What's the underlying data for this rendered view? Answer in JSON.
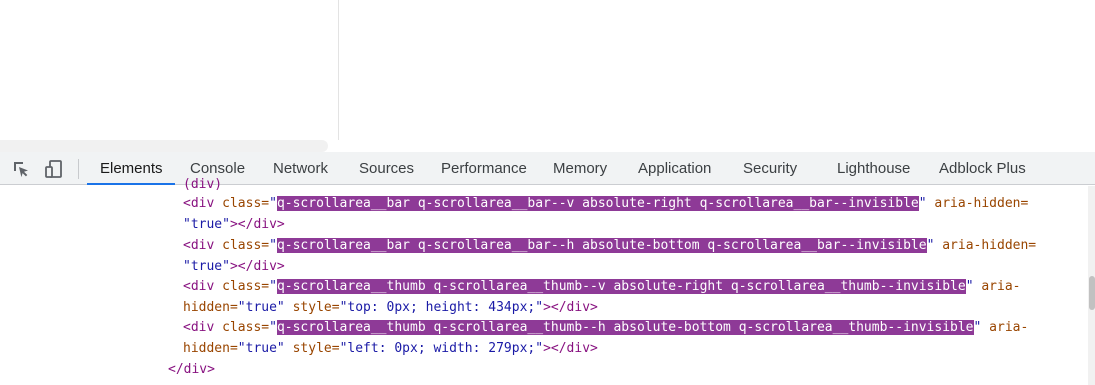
{
  "toolbar": {
    "inspect_icon": "element-picker-icon",
    "device_icon": "device-toolbar-icon",
    "tabs": [
      {
        "label": "Elements",
        "active": true
      },
      {
        "label": "Console"
      },
      {
        "label": "Network"
      },
      {
        "label": "Sources"
      },
      {
        "label": "Performance"
      },
      {
        "label": "Memory"
      },
      {
        "label": "Application"
      },
      {
        "label": "Security"
      },
      {
        "label": "Lighthouse"
      },
      {
        "label": "Adblock Plus"
      }
    ]
  },
  "colors": {
    "highlight": "#8e3a97",
    "tag": "#881280",
    "attr": "#994500",
    "value": "#1a1aa6",
    "active_tab_underline": "#1a73e8"
  },
  "code": {
    "clipped_top": "(div)",
    "lines": [
      {
        "open": "<div",
        "attr1": " class=",
        "q1": "\"",
        "hl": "q-scrollarea__bar q-scrollarea__bar--v absolute-right q-scrollarea__bar--invisible",
        "q2": "\"",
        "attr2": " aria-hidden=",
        "cont": "\"true\"",
        "close": "></div>"
      },
      {
        "open": "<div",
        "attr1": " class=",
        "q1": "\"",
        "hl": "q-scrollarea__bar q-scrollarea__bar--h absolute-bottom q-scrollarea__bar--invisible",
        "q2": "\"",
        "attr2": " aria-hidden=",
        "cont": "\"true\"",
        "close": "></div>"
      },
      {
        "open": "<div",
        "attr1": " class=",
        "q1": "\"",
        "hl": "q-scrollarea__thumb q-scrollarea__thumb--v absolute-right q-scrollarea__thumb--invisible",
        "q2": "\"",
        "attr2": " aria-",
        "cont_attr": "hidden=",
        "cont_val": "\"true\"",
        "style_attr": " style=",
        "style_val": "\"top: 0px; height: 434px;\"",
        "close": "></div>"
      },
      {
        "open": "<div",
        "attr1": " class=",
        "q1": "\"",
        "hl": "q-scrollarea__thumb q-scrollarea__thumb--h absolute-bottom q-scrollarea__thumb--invisible",
        "q2": "\"",
        "attr2": " aria-",
        "cont_attr": "hidden=",
        "cont_val": "\"true\"",
        "style_attr": " style=",
        "style_val": "\"left: 0px; width: 279px;\"",
        "close": "></div>"
      }
    ],
    "closing": "</div>"
  }
}
